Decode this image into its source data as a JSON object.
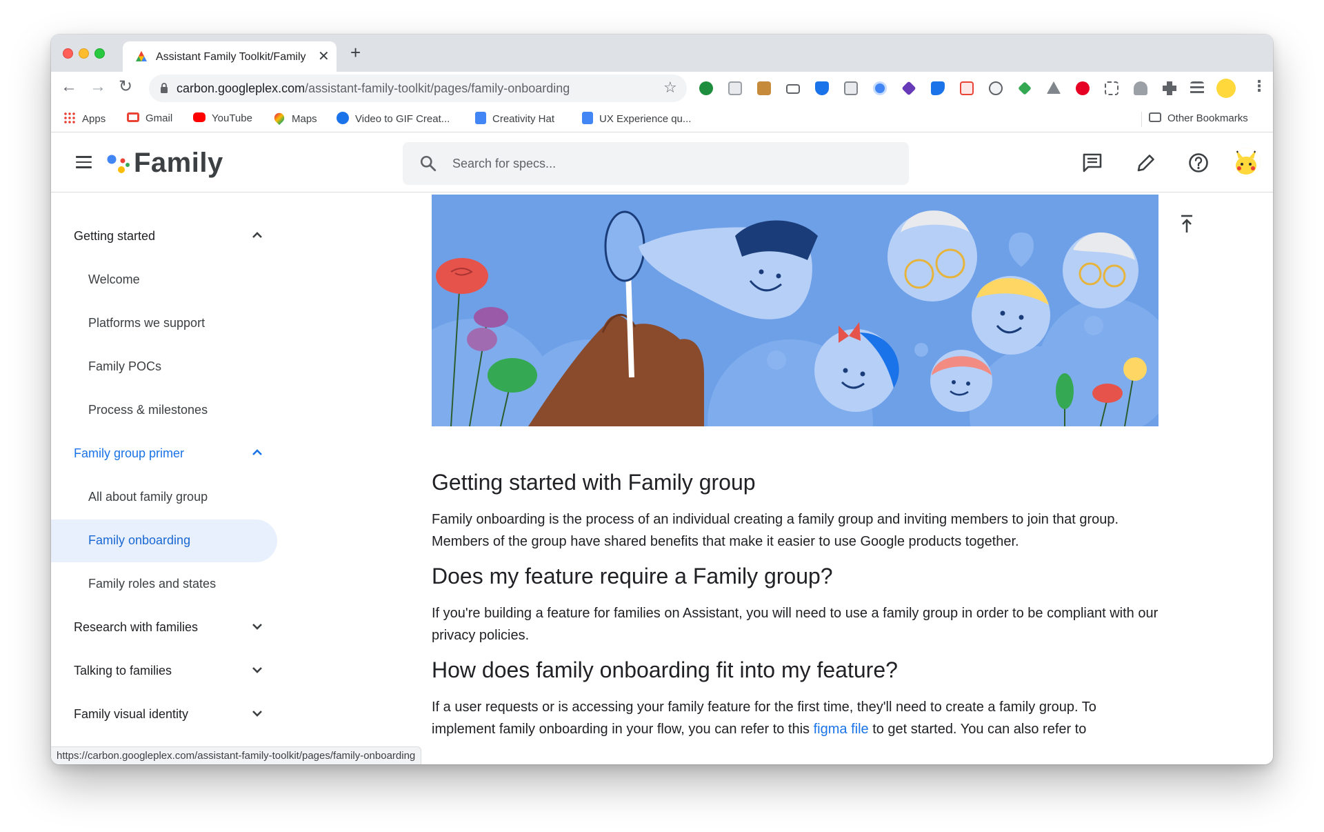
{
  "browser": {
    "tab_title": "Assistant Family Toolkit/Family",
    "tab_close": "✕",
    "new_tab": "+",
    "url_host": "carbon.googleplex.com",
    "url_path": "/assistant-family-toolkit/pages/family-onboarding",
    "star": "☆",
    "back": "←",
    "forward": "→",
    "reload": "↻",
    "menu": "⋮",
    "bookmarks": [
      {
        "label": "Apps",
        "icon": "apps-grid-icon",
        "color": "#ea4335"
      },
      {
        "label": "Gmail",
        "icon": "gmail-icon",
        "color": "#ea4335"
      },
      {
        "label": "YouTube",
        "icon": "youtube-icon",
        "color": "#ff0000"
      },
      {
        "label": "Maps",
        "icon": "maps-pin-icon",
        "color": "#34a853"
      },
      {
        "label": "Video to GIF Creat...",
        "icon": "gif-icon",
        "color": "#1a73e8"
      },
      {
        "label": "Creativity Hat",
        "icon": "docs-icon",
        "color": "#4285f4"
      },
      {
        "label": "UX Experience qu...",
        "icon": "docs-icon",
        "color": "#4285f4"
      }
    ],
    "other_bookmarks": "Other Bookmarks",
    "status_url": "https://carbon.googleplex.com/assistant-family-toolkit/pages/family-onboarding"
  },
  "header": {
    "brand": "Family",
    "search_placeholder": "Search for specs..."
  },
  "sidebar": {
    "sections": [
      {
        "label": "Getting started",
        "expanded": true,
        "items": [
          "Welcome",
          "Platforms we support",
          "Family POCs",
          "Process & milestones"
        ]
      },
      {
        "label": "Family group primer",
        "expanded": true,
        "active": true,
        "items": [
          "All about family group",
          "Family onboarding",
          "Family roles and states"
        ]
      },
      {
        "label": "Research with families",
        "expanded": false
      },
      {
        "label": "Talking to families",
        "expanded": false
      },
      {
        "label": "Family visual identity",
        "expanded": false
      }
    ],
    "selected_item": "Family onboarding"
  },
  "article": {
    "h1": "Getting started with Family group",
    "p1": "Family onboarding is the process of an individual creating a family group and inviting members to join that group. Members of the group have shared benefits that make it easier to use Google products together.",
    "h2": "Does my feature require a Family group?",
    "p2": "If you're building a feature for families on Assistant, you will need to use a family group in order to be compliant with our privacy policies.",
    "h3": "How does family onboarding fit into my feature?",
    "p3_a": "If a user requests or is accessing your family feature for the first time, they'll need to create a family group. To implement family onboarding in your flow, you can refer to this ",
    "p3_link": "figma file",
    "p3_b": " to get started. You can also refer to"
  },
  "colors": {
    "accent": "#1a73e8",
    "selected_bg": "#e8f0fe",
    "hero_bg": "#6ea0e8"
  }
}
